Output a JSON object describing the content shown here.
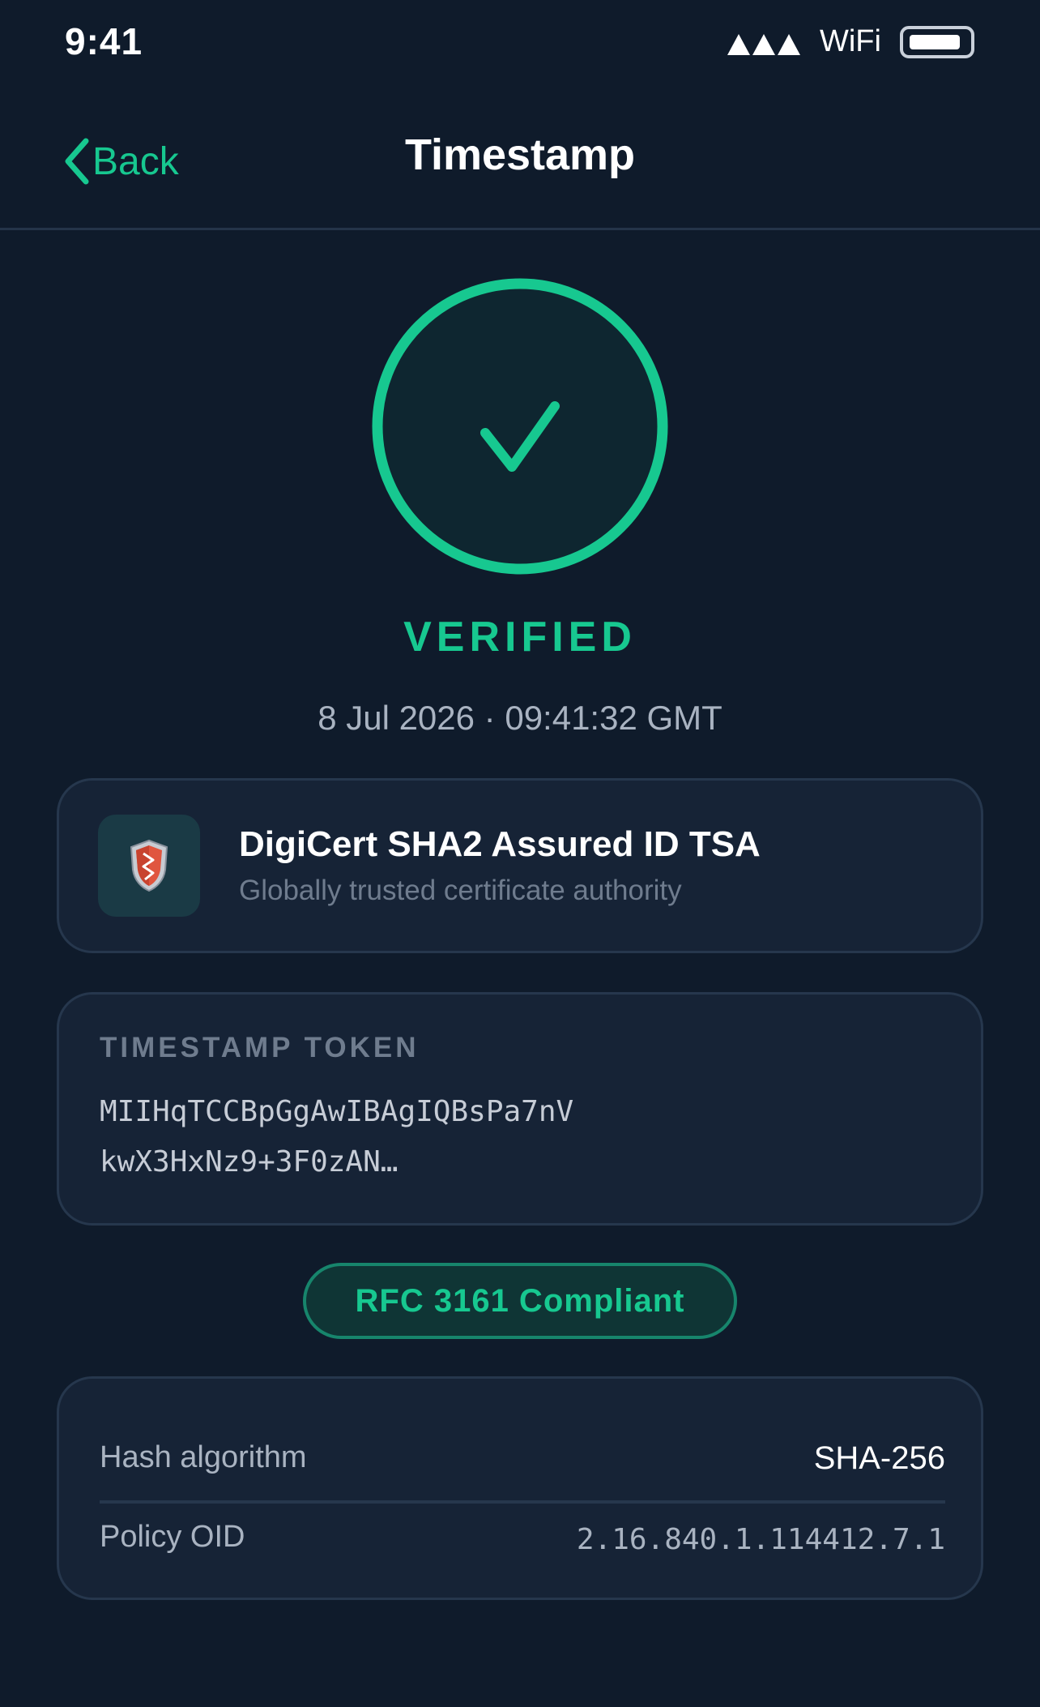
{
  "status_bar": {
    "time": "9:41",
    "network_label": "WiFi",
    "icons": [
      "signal-icon",
      "battery-icon"
    ]
  },
  "nav": {
    "back_label": "Back",
    "title": "Timestamp"
  },
  "verification": {
    "status": "VERIFIED",
    "datetime": "8 Jul 2026 · 09:41:32 GMT",
    "icon": "checkmark-icon",
    "accent_color": "#17c890"
  },
  "authority": {
    "name": "DigiCert SHA2 Assured ID TSA",
    "description": "Globally trusted certificate authority",
    "icon": "shield-icon"
  },
  "token": {
    "heading": "TIMESTAMP TOKEN",
    "line1": "MIIHqTCCBpGgAwIBAgIQBsPa7nV",
    "line2": "kwX3HxNz9+3F0zAN…"
  },
  "badge": {
    "label": "RFC 3161 Compliant"
  },
  "details": {
    "rows": [
      {
        "label": "Hash algorithm",
        "value": "SHA-256"
      },
      {
        "label": "Policy OID",
        "value": "2.16.840.1.114412.7.1"
      }
    ]
  },
  "colors": {
    "background": "#0f1b2b",
    "card": "#162336",
    "accent": "#17c890"
  }
}
